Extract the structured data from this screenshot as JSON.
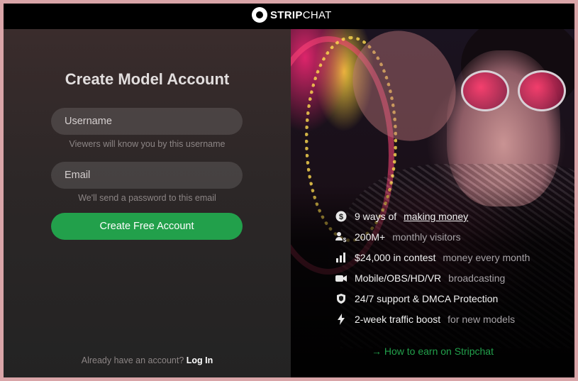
{
  "brand": {
    "strong": "STRIP",
    "rest": "CHAT"
  },
  "form": {
    "title": "Create Model Account",
    "username": {
      "placeholder": "Username",
      "hint": "Viewers will know you by this username"
    },
    "email": {
      "placeholder": "Email",
      "hint": "We'll send a password to this email"
    },
    "submit_label": "Create Free Account",
    "login_prompt": "Already have an account?",
    "login_link": "Log In"
  },
  "features": [
    {
      "icon": "dollar-icon",
      "lead": "9 ways of",
      "highlight": "making money",
      "tail": ""
    },
    {
      "icon": "visitors-icon",
      "lead": "200M+",
      "highlight": "",
      "tail": "monthly visitors"
    },
    {
      "icon": "chart-icon",
      "lead": "$24,000 in contest",
      "highlight": "",
      "tail": "money every month"
    },
    {
      "icon": "camera-icon",
      "lead": "Mobile/OBS/HD/VR",
      "highlight": "",
      "tail": "broadcasting"
    },
    {
      "icon": "shield-icon",
      "lead": "24/7 support & DMCA Protection",
      "highlight": "",
      "tail": ""
    },
    {
      "icon": "lightning-icon",
      "lead": "2-week traffic boost",
      "highlight": "",
      "tail": "for new models"
    }
  ],
  "earn_link": "How to earn on Stripchat",
  "colors": {
    "accent": "#22a04b",
    "frame": "#d9a5a8"
  }
}
